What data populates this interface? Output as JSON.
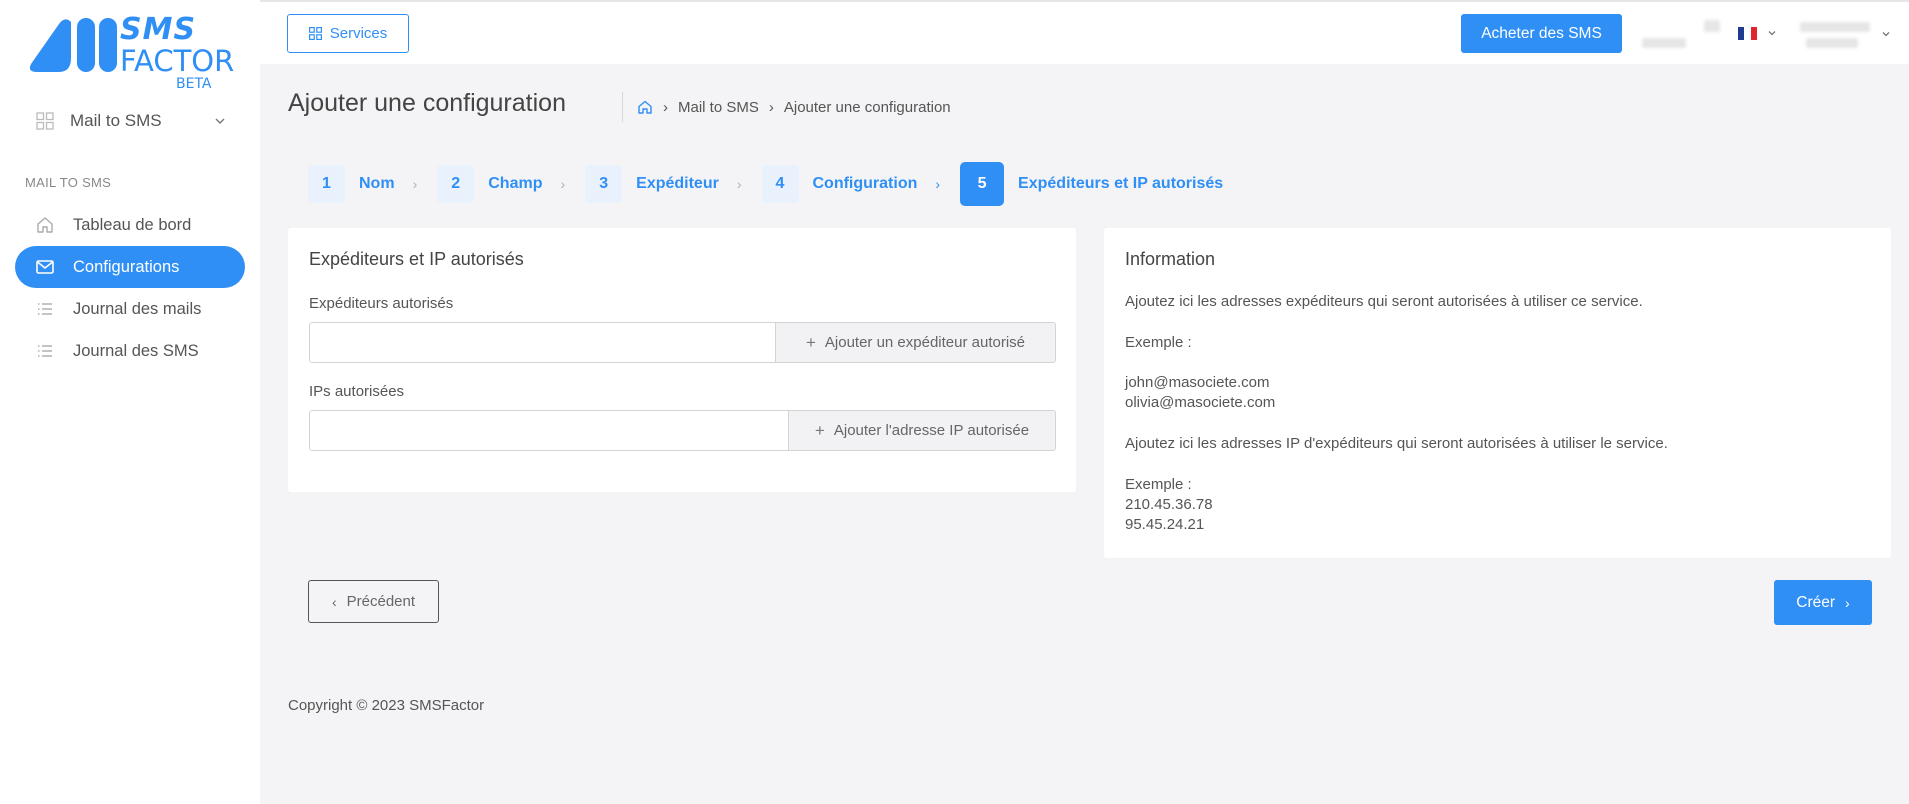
{
  "brand": {
    "name_line1": "SMS",
    "name_line2": "FACTOR",
    "tag": "BETA",
    "color": "#2f8ff5"
  },
  "sidebar": {
    "service_select": {
      "label": "Mail to SMS",
      "icon": "grid-icon"
    },
    "section_title": "MAIL TO SMS",
    "items": [
      {
        "label": "Tableau de bord",
        "icon": "home-icon",
        "active": false
      },
      {
        "label": "Configurations",
        "icon": "mail-icon",
        "active": true
      },
      {
        "label": "Journal des mails",
        "icon": "list-icon",
        "active": false
      },
      {
        "label": "Journal des SMS",
        "icon": "list-icon",
        "active": false
      }
    ]
  },
  "topbar": {
    "services_label": "Services",
    "buy_label": "Acheter des SMS",
    "language_flag": "FR"
  },
  "page": {
    "title": "Ajouter une configuration",
    "breadcrumb": [
      "Mail to SMS",
      "Ajouter une configuration"
    ]
  },
  "steps": [
    {
      "num": "1",
      "label": "Nom"
    },
    {
      "num": "2",
      "label": "Champ"
    },
    {
      "num": "3",
      "label": "Expéditeur"
    },
    {
      "num": "4",
      "label": "Configuration"
    },
    {
      "num": "5",
      "label": "Expéditeurs et IP autorisés",
      "active": true
    }
  ],
  "form": {
    "title": "Expéditeurs et IP autorisés",
    "senders_label": "Expéditeurs autorisés",
    "senders_value": "",
    "senders_add": "Ajouter un expéditeur autorisé",
    "ips_label": "IPs autorisées",
    "ips_value": "",
    "ips_add": "Ajouter l'adresse IP autorisée"
  },
  "info": {
    "title": "Information",
    "p1": "Ajoutez ici les adresses expéditeurs qui seront autorisées à utiliser ce service.",
    "example1_label": "Exemple :",
    "example1_line1": "john@masociete.com",
    "example1_line2": "olivia@masociete.com",
    "p2": "Ajoutez ici les adresses IP d'expéditeurs qui seront autorisées à utiliser le service.",
    "example2_label": "Exemple :",
    "example2_line1": "210.45.36.78",
    "example2_line2": "95.45.24.21"
  },
  "actions": {
    "prev_label": "Précédent",
    "create_label": "Créer"
  },
  "footer": {
    "copyright": "Copyright © 2023 SMSFactor"
  }
}
